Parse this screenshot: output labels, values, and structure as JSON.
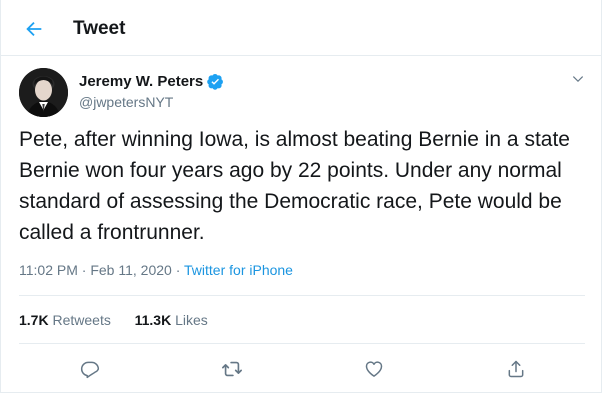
{
  "header": {
    "title": "Tweet"
  },
  "author": {
    "name": "Jeremy W. Peters",
    "handle": "@jwpetersNYT"
  },
  "tweet": {
    "text": "Pete, after winning Iowa, is almost beating Bernie in a state Bernie won four years ago by 22 points. Under any normal standard of assessing the Democratic race, Pete would be called a frontrunner.",
    "time": "11:02 PM",
    "sep": " · ",
    "date": "Feb 11, 2020",
    "source": "Twitter for iPhone"
  },
  "stats": {
    "retweets_count": "1.7K",
    "retweets_label": "Retweets",
    "likes_count": "11.3K",
    "likes_label": "Likes"
  },
  "icons": {
    "back": "arrow-left-icon",
    "verified": "verified-badge-icon",
    "more": "chevron-down-icon",
    "reply": "reply-icon",
    "retweet": "retweet-icon",
    "like": "heart-icon",
    "share": "share-icon"
  },
  "colors": {
    "accent": "#1da1f2",
    "link": "#1b95e0",
    "muted": "#657786",
    "text": "#14171a"
  }
}
